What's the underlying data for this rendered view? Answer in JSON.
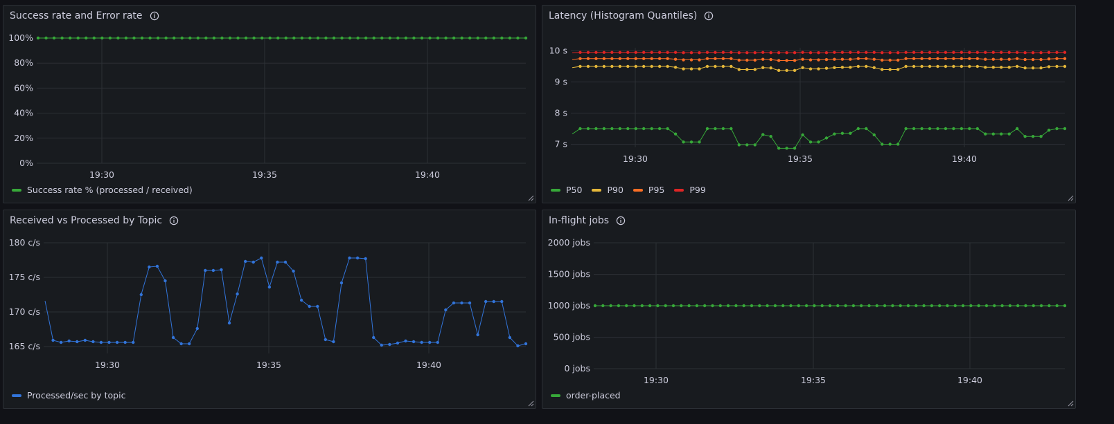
{
  "colors": {
    "green": "#37a839",
    "yellow": "#e4b73a",
    "orange": "#fa6e25",
    "red": "#dd2525",
    "blue": "#3274d9",
    "grid": "#2d3036",
    "background": "#181b1f"
  },
  "panels": [
    {
      "title": "Success rate and Error rate",
      "info_icon": "info-circle-icon",
      "chart_data": {
        "type": "line",
        "x_ticks": [
          "19:30",
          "19:35",
          "19:40"
        ],
        "y_ticks": [
          "0%",
          "20%",
          "40%",
          "60%",
          "80%",
          "100%"
        ],
        "ylim": [
          0,
          100
        ],
        "series": [
          {
            "name": "Success rate % (processed / received)",
            "color": "green",
            "values": [
              100,
              100,
              100,
              100,
              100,
              100,
              100,
              100,
              100,
              100,
              100,
              100,
              100,
              100,
              100,
              100,
              100,
              100,
              100,
              100,
              100,
              100,
              100,
              100,
              100,
              100,
              100,
              100,
              100,
              100,
              100,
              100,
              100,
              100,
              100,
              100,
              100,
              100,
              100,
              100,
              100,
              100,
              100,
              100,
              100,
              100,
              100,
              100,
              100,
              100,
              100,
              100,
              100,
              100,
              100,
              100,
              100,
              100,
              100,
              100,
              100,
              100
            ]
          }
        ],
        "legend_placement": "bottom-left"
      }
    },
    {
      "title": "Latency (Histogram Quantiles)",
      "info_icon": "info-circle-icon",
      "chart_data": {
        "type": "line",
        "x_ticks": [
          "19:30",
          "19:35",
          "19:40"
        ],
        "y_ticks": [
          "7 s",
          "8 s",
          "9 s",
          "10 s"
        ],
        "ylim": [
          6.9,
          10.1
        ],
        "series": [
          {
            "name": "P50",
            "color": "green",
            "values": [
              7.33,
              7.5,
              7.5,
              7.5,
              7.5,
              7.5,
              7.5,
              7.5,
              7.5,
              7.5,
              7.5,
              7.5,
              7.5,
              7.33,
              7.07,
              7.07,
              7.07,
              7.5,
              7.5,
              7.5,
              7.5,
              6.98,
              6.98,
              6.98,
              7.31,
              7.25,
              6.87,
              6.87,
              6.87,
              7.3,
              7.07,
              7.07,
              7.2,
              7.33,
              7.35,
              7.35,
              7.5,
              7.5,
              7.3,
              7.0,
              7.0,
              7.0,
              7.5,
              7.5,
              7.5,
              7.5,
              7.5,
              7.5,
              7.5,
              7.5,
              7.5,
              7.5,
              7.33,
              7.33,
              7.33,
              7.33,
              7.5,
              7.25,
              7.25,
              7.25,
              7.45,
              7.5,
              7.5
            ]
          },
          {
            "name": "P90",
            "color": "yellow",
            "values": [
              9.46,
              9.5,
              9.5,
              9.5,
              9.5,
              9.5,
              9.5,
              9.5,
              9.5,
              9.5,
              9.5,
              9.5,
              9.5,
              9.47,
              9.42,
              9.42,
              9.42,
              9.5,
              9.5,
              9.5,
              9.5,
              9.4,
              9.4,
              9.4,
              9.46,
              9.45,
              9.37,
              9.37,
              9.37,
              9.46,
              9.42,
              9.42,
              9.44,
              9.46,
              9.47,
              9.47,
              9.5,
              9.5,
              9.46,
              9.4,
              9.4,
              9.4,
              9.5,
              9.5,
              9.5,
              9.5,
              9.5,
              9.5,
              9.5,
              9.5,
              9.5,
              9.5,
              9.47,
              9.47,
              9.47,
              9.47,
              9.5,
              9.45,
              9.45,
              9.45,
              9.49,
              9.5,
              9.5
            ]
          },
          {
            "name": "P95",
            "color": "orange",
            "values": [
              9.72,
              9.75,
              9.75,
              9.75,
              9.75,
              9.75,
              9.75,
              9.75,
              9.75,
              9.75,
              9.75,
              9.75,
              9.75,
              9.73,
              9.71,
              9.71,
              9.71,
              9.75,
              9.75,
              9.75,
              9.75,
              9.7,
              9.7,
              9.7,
              9.73,
              9.72,
              9.69,
              9.69,
              9.69,
              9.73,
              9.71,
              9.71,
              9.72,
              9.73,
              9.73,
              9.73,
              9.75,
              9.75,
              9.73,
              9.7,
              9.7,
              9.7,
              9.75,
              9.75,
              9.75,
              9.75,
              9.75,
              9.75,
              9.75,
              9.75,
              9.75,
              9.75,
              9.73,
              9.73,
              9.73,
              9.73,
              9.75,
              9.72,
              9.72,
              9.72,
              9.74,
              9.75,
              9.75
            ]
          },
          {
            "name": "P99",
            "color": "red",
            "values": [
              9.94,
              9.95,
              9.95,
              9.95,
              9.95,
              9.95,
              9.95,
              9.95,
              9.95,
              9.95,
              9.95,
              9.95,
              9.95,
              9.95,
              9.94,
              9.94,
              9.94,
              9.95,
              9.95,
              9.95,
              9.95,
              9.94,
              9.94,
              9.94,
              9.95,
              9.94,
              9.94,
              9.94,
              9.94,
              9.95,
              9.94,
              9.94,
              9.94,
              9.95,
              9.95,
              9.95,
              9.95,
              9.95,
              9.95,
              9.94,
              9.94,
              9.94,
              9.95,
              9.95,
              9.95,
              9.95,
              9.95,
              9.95,
              9.95,
              9.95,
              9.95,
              9.95,
              9.95,
              9.95,
              9.95,
              9.95,
              9.95,
              9.94,
              9.94,
              9.94,
              9.95,
              9.95,
              9.95
            ]
          }
        ],
        "legend_placement": "bottom-left"
      }
    },
    {
      "title": "Received vs Processed by Topic",
      "info_icon": "info-circle-icon",
      "chart_data": {
        "type": "line",
        "x_ticks": [
          "19:30",
          "19:35",
          "19:40"
        ],
        "y_ticks": [
          "165 c/s",
          "170 c/s",
          "175 c/s",
          "180 c/s"
        ],
        "ylim": [
          164,
          180
        ],
        "series": [
          {
            "name": "Processed/sec by topic",
            "color": "blue",
            "values": [
              171.6,
              165.9,
              165.6,
              165.8,
              165.7,
              165.9,
              165.7,
              165.6,
              165.6,
              165.6,
              165.6,
              165.6,
              172.5,
              176.5,
              176.6,
              174.5,
              166.3,
              165.4,
              165.4,
              167.6,
              176.0,
              176.0,
              176.1,
              168.4,
              172.6,
              177.3,
              177.2,
              177.8,
              173.6,
              177.2,
              177.2,
              175.9,
              171.7,
              170.8,
              170.8,
              166.0,
              165.7,
              174.2,
              177.8,
              177.8,
              177.7,
              166.3,
              165.2,
              165.3,
              165.5,
              165.8,
              165.7,
              165.6,
              165.6,
              165.6,
              170.3,
              171.3,
              171.3,
              171.3,
              166.7,
              171.5,
              171.5,
              171.5,
              166.3,
              165.1,
              165.4
            ]
          }
        ],
        "legend_placement": "bottom-left"
      }
    },
    {
      "title": "In-flight jobs",
      "info_icon": "info-circle-icon",
      "chart_data": {
        "type": "line",
        "x_ticks": [
          "19:30",
          "19:35",
          "19:40"
        ],
        "y_ticks": [
          "0 jobs",
          "500 jobs",
          "1000 jobs",
          "1500 jobs",
          "2000 jobs"
        ],
        "ylim": [
          0,
          2000
        ],
        "series": [
          {
            "name": "order-placed",
            "color": "green",
            "values": [
              1000,
              1000,
              1000,
              1000,
              1000,
              1000,
              1000,
              1000,
              1000,
              1000,
              1000,
              1000,
              1000,
              1000,
              1000,
              1000,
              1000,
              1000,
              1000,
              1000,
              1000,
              1000,
              1000,
              1000,
              1000,
              1000,
              1000,
              1000,
              1000,
              1000,
              1000,
              1000,
              1000,
              1000,
              1000,
              1000,
              1000,
              1000,
              1000,
              1000,
              1000,
              1000,
              1000,
              1000,
              1000,
              1000,
              1000,
              1000,
              1000,
              1000,
              1000,
              1000,
              1000,
              1000,
              1000,
              1000,
              1000,
              1000,
              1000,
              1000,
              1000
            ]
          }
        ],
        "legend_placement": "bottom-left"
      }
    }
  ]
}
